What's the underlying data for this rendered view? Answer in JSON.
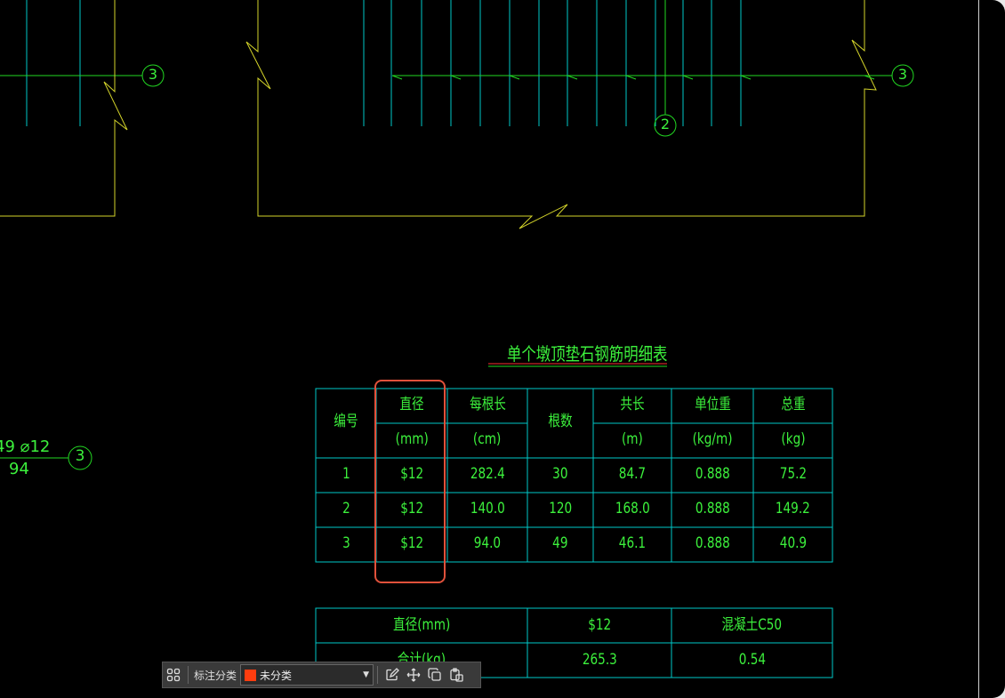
{
  "drawing": {
    "table_title": "单个墩顶垫石钢筋明细表",
    "axis_markers": [
      "3",
      "3",
      "2",
      "3"
    ],
    "left_label_top": "49 ⌀12",
    "left_label_bottom": "94",
    "table1": {
      "headers": [
        {
          "top": "编号",
          "bottom": ""
        },
        {
          "top": "直径",
          "bottom": "(mm)"
        },
        {
          "top": "每根长",
          "bottom": "(cm)"
        },
        {
          "top": "根数",
          "bottom": ""
        },
        {
          "top": "共长",
          "bottom": "(m)"
        },
        {
          "top": "单位重",
          "bottom": "(kg/m)"
        },
        {
          "top": "总重",
          "bottom": "(kg)"
        }
      ],
      "rows": [
        [
          "1",
          "$12",
          "282.4",
          "30",
          "84.7",
          "0.888",
          "75.2"
        ],
        [
          "2",
          "$12",
          "140.0",
          "120",
          "168.0",
          "0.888",
          "149.2"
        ],
        [
          "3",
          "$12",
          "94.0",
          "49",
          "46.1",
          "0.888",
          "40.9"
        ]
      ]
    },
    "table2": {
      "rows": [
        [
          "直径(mm)",
          "$12",
          "混凝土C50"
        ],
        [
          "合计(kg)",
          "265.3",
          "0.54"
        ]
      ]
    }
  },
  "toolbar": {
    "grid_icon": "grid-icon",
    "category_label": "标注分类",
    "category_value": "未分类",
    "category_color": "#ff3d0f",
    "icons": [
      "edit-icon",
      "move-icon",
      "copy-icon",
      "paste-icon"
    ]
  },
  "colors": {
    "background": "#000000",
    "text_green": "#3cf03c",
    "line_cyan": "#00c8c8",
    "line_yellow": "#d4d42a",
    "line_green": "#22d822",
    "highlight": "#e0513b"
  }
}
